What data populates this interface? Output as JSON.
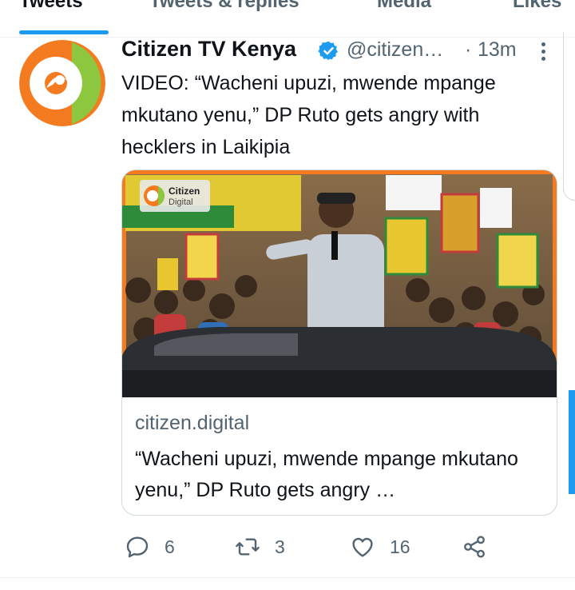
{
  "tabs": [
    {
      "label": "Tweets",
      "active": true
    },
    {
      "label": "Tweets & replies",
      "active": false
    },
    {
      "label": "Media",
      "active": false
    },
    {
      "label": "Likes",
      "active": false
    }
  ],
  "tweet": {
    "author_name": "Citizen TV Kenya",
    "handle": "@citizen…",
    "separator": "·",
    "time": "13m",
    "text": "VIDEO: “Wacheni upuzi, mwende mpange mkutano yenu,” DP Ruto gets angry with hecklers in Laikipia",
    "card": {
      "image_badge": "Citizen Digital",
      "domain": "citizen.digital",
      "title": "“Wacheni upuzi, mwende mpange mkutano yenu,” DP Ruto gets angry …"
    },
    "actions": {
      "replies": "6",
      "retweets": "3",
      "likes": "16"
    }
  },
  "colors": {
    "accent": "#1d9bf0",
    "logo_orange": "#f47b20",
    "logo_green": "#8dc63f",
    "muted_text": "#536471"
  }
}
